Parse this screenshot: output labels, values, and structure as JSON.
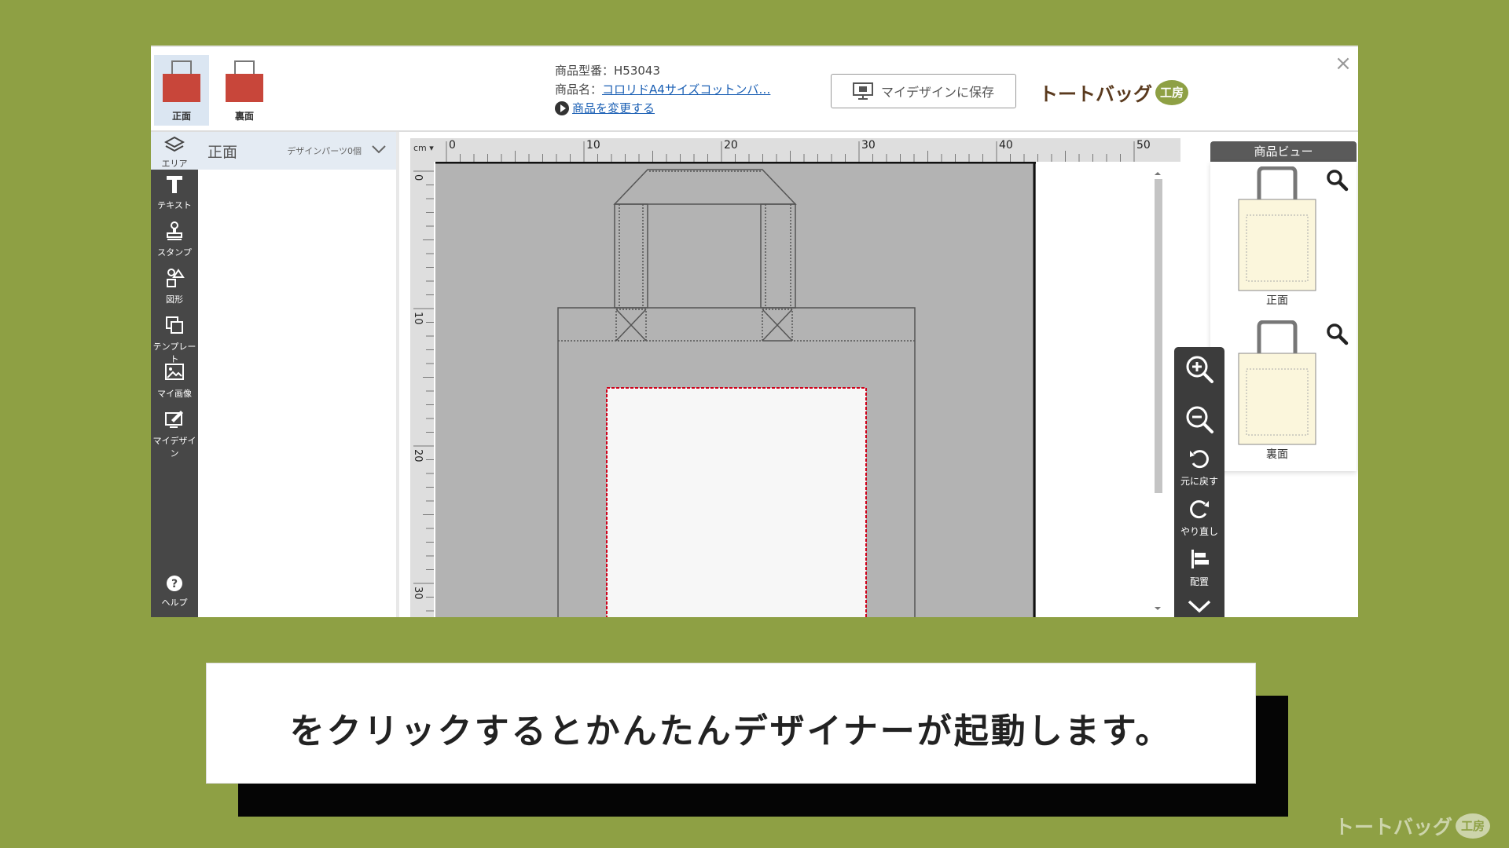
{
  "header": {
    "faces": [
      {
        "label": "正面",
        "active": true
      },
      {
        "label": "裏面",
        "active": false
      }
    ],
    "product_code_line": "商品型番：H53043",
    "product_name_prefix": "商品名：",
    "product_name_link": "コロリドA4サイズコットンバ…",
    "change_product_link": "商品を変更する",
    "save_button_label": "マイデザインに保存",
    "logo_text": "トートバッグ",
    "logo_badge": "工房"
  },
  "toolbar": {
    "area_label": "エリア",
    "tools": [
      "テキスト",
      "スタンプ",
      "図形",
      "テンプレート",
      "マイ画像",
      "マイデザイン"
    ],
    "help_label": "ヘルプ"
  },
  "parts_panel": {
    "title": "正面",
    "count_label": "デザインパーツ0個"
  },
  "canvas": {
    "unit_label": "cm",
    "top_ruler_labels": [
      "0",
      "10",
      "20",
      "30",
      "40",
      "50"
    ],
    "left_ruler_labels": [
      "0",
      "10",
      "20",
      "30"
    ],
    "bag_color": "#b3b3b3",
    "print_area_border_color": "#d0021b"
  },
  "product_view": {
    "title": "商品ビュー",
    "items": [
      {
        "label": "正面"
      },
      {
        "label": "裏面"
      }
    ]
  },
  "vertical_tools": {
    "undo_label": "元に戻す",
    "redo_label": "やり直し",
    "align_label": "配置"
  },
  "caption": {
    "text": "をクリックするとかんたんデザイナーが起動します。"
  },
  "watermark": {
    "text": "トートバッグ",
    "badge": "工房"
  },
  "colors": {
    "background": "#8ea044",
    "toolbar": "#474747",
    "bag_thumb": "#c8463a"
  }
}
